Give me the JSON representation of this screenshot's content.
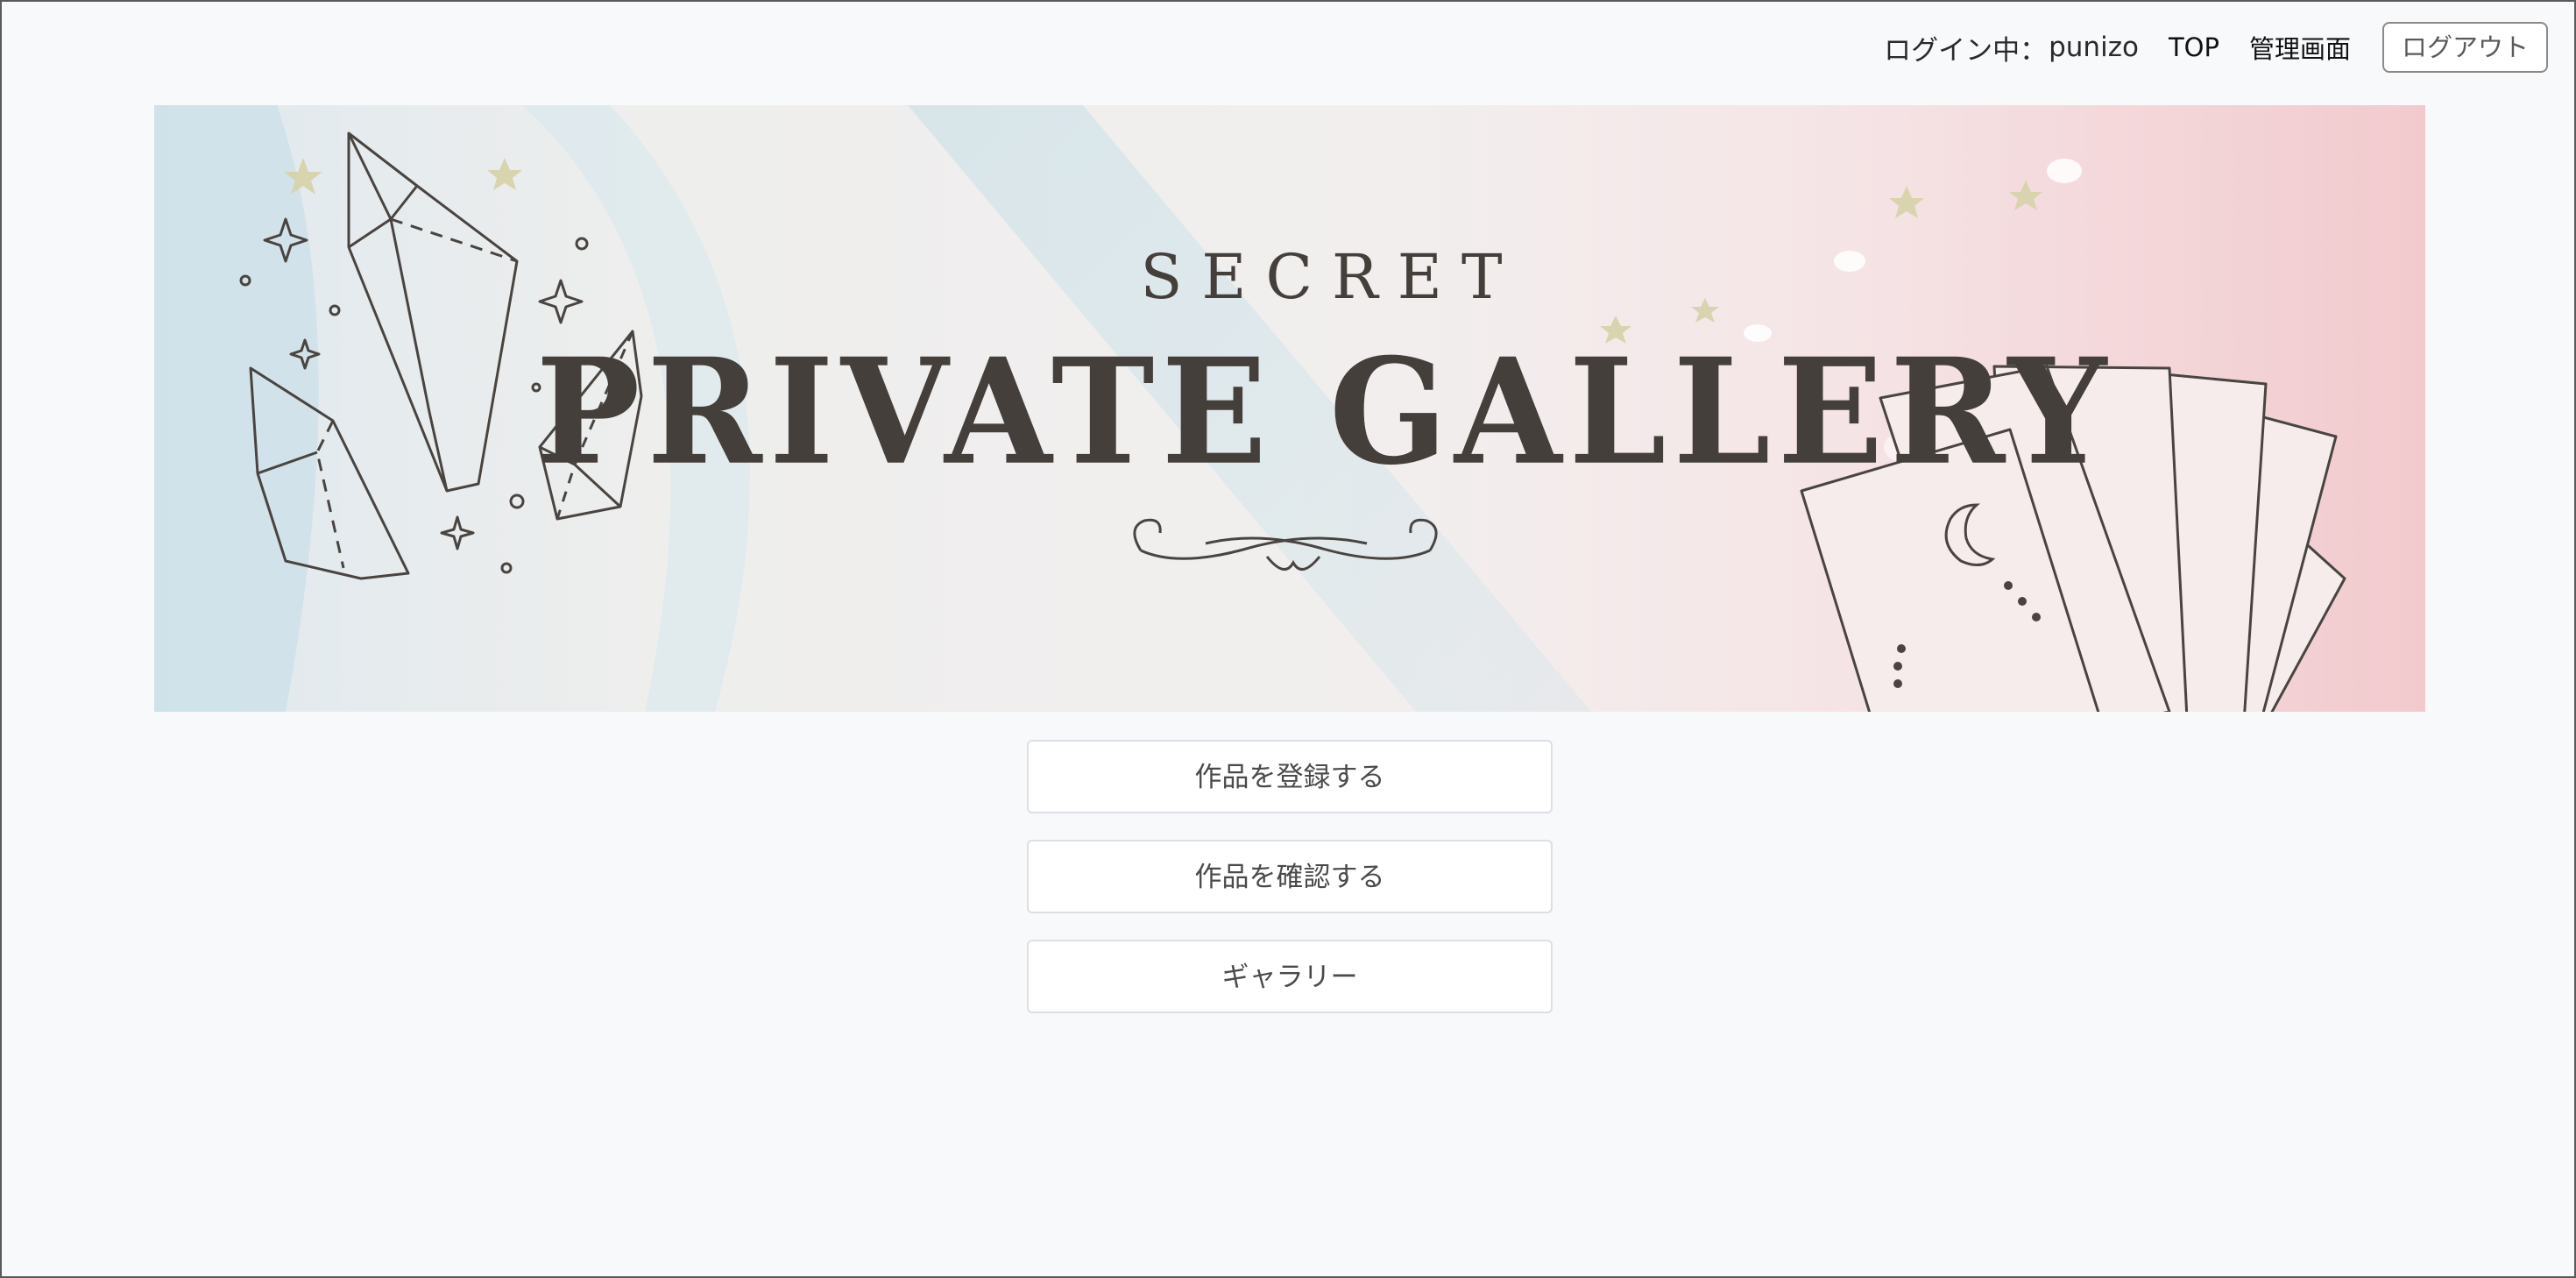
{
  "header": {
    "login_label": "ログイン中：",
    "username": "punizo",
    "nav": {
      "top": "TOP",
      "admin": "管理画面"
    },
    "logout": "ログアウト"
  },
  "banner": {
    "secret": "SECRET",
    "title": "PRIVATE GALLERY"
  },
  "menu": {
    "register": "作品を登録する",
    "confirm": "作品を確認する",
    "gallery": "ギャラリー"
  },
  "colors": {
    "page_background": "#f8f9fb",
    "banner_ink": "#453f3b",
    "button_border": "#dcdfe3"
  }
}
